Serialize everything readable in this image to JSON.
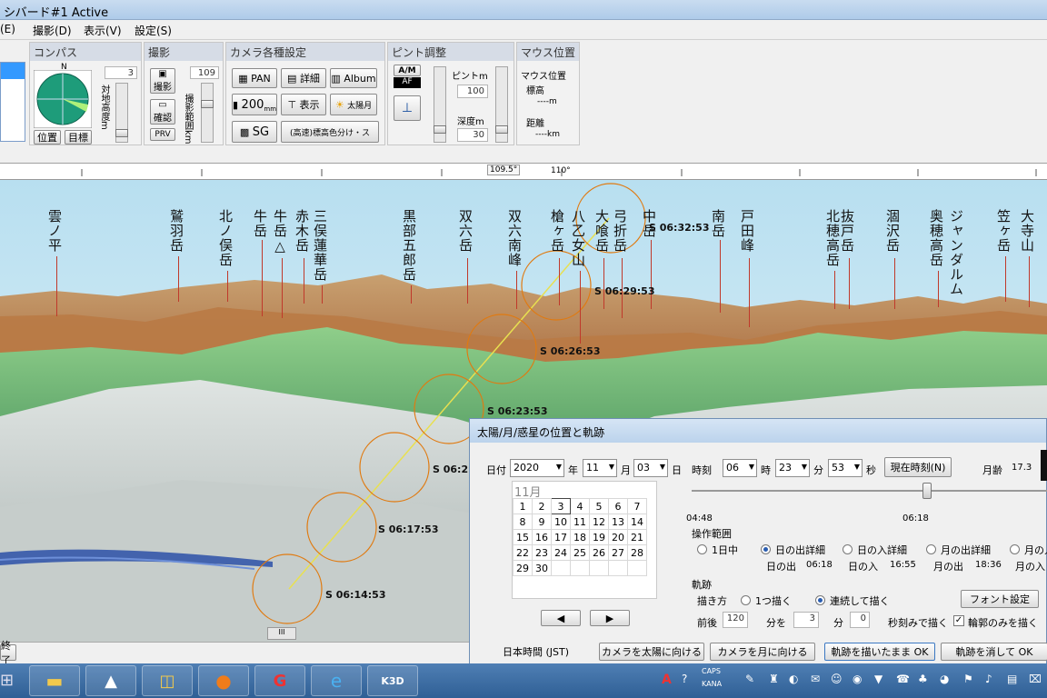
{
  "window": {
    "title": "シバード#1 Active"
  },
  "menu": [
    "(E)",
    "撮影(D)",
    "表示(V)",
    "設定(S)"
  ],
  "compass": {
    "title": "コンパス",
    "north": "N",
    "height_value": "3",
    "height_label": "対地高度m",
    "pos_button": "位置",
    "target_button": "目標"
  },
  "shoot": {
    "title": "撮影",
    "shoot_button": "撮影",
    "confirm_button": "確認",
    "prv_button": "PRV",
    "range_value": "109",
    "range_label": "撮影範囲km"
  },
  "camera": {
    "title": "カメラ各種設定",
    "pan": "PAN",
    "detail": "詳細",
    "album": "Album",
    "mm": "200",
    "mm_unit": "mm",
    "display": "表示",
    "sun_moon": "太陽月",
    "sg": "SG",
    "color_mode": "(高速)標高色分け・ス"
  },
  "focus": {
    "title": "ピント調整",
    "am": "A/M",
    "af": "AF",
    "focus_label": "ピントm",
    "focus_value": "100",
    "depth_label": "深度m",
    "depth_value": "30"
  },
  "mouse": {
    "title": "マウス位置",
    "pos_label": "マウス位置",
    "elev_label": "標高",
    "elev_value": "----m",
    "dist_label": "距離",
    "dist_value": "----km"
  },
  "ruler": {
    "marker": "109.5°",
    "label": "110°"
  },
  "peaks": [
    "雲ノ平",
    "鷲羽岳",
    "北ノ俣岳",
    "牛岳",
    "牛岳△",
    "赤木岳",
    "三俣蓮華岳",
    "黒部五郎岳",
    "双六岳",
    "双六南峰",
    "槍ヶ岳",
    "八乙女山",
    "大喰岳",
    "弓折岳",
    "中岳",
    "南岳",
    "戸田峰",
    "北穂高岳",
    "抜戸岳",
    "涸沢岳",
    "奥穂高岳",
    "ジャンダルム",
    "笠ヶ岳",
    "大寺山"
  ],
  "sun_labels": [
    "S 06:32:53",
    "S 06:29:53",
    "S 06:26:53",
    "S 06:23:53",
    "S 06:2",
    "S 06:17:53",
    "S 06:14:53"
  ],
  "status": {
    "left_button": "終了"
  },
  "dialog": {
    "title": "太陽/月/惑星の位置と軌跡",
    "date_label": "日付",
    "year": "2020",
    "year_unit": "年",
    "month": "11",
    "month_unit": "月",
    "day": "03",
    "day_unit": "日",
    "time_label": "時刻",
    "hour": "06",
    "hour_unit": "時",
    "minute": "23",
    "minute_unit": "分",
    "second": "53",
    "second_unit": "秒",
    "now_button": "現在時刻(N)",
    "moon_age_label": "月齢",
    "moon_age": "17.3",
    "cal_month": "11月",
    "cal_days": [
      [
        1,
        2,
        3,
        4,
        5,
        6,
        7
      ],
      [
        8,
        9,
        10,
        11,
        12,
        13,
        14
      ],
      [
        15,
        16,
        17,
        18,
        19,
        20,
        21
      ],
      [
        22,
        23,
        24,
        25,
        26,
        27,
        28
      ],
      [
        29,
        30
      ]
    ],
    "slider_start": "04:48",
    "slider_cur": "06:18",
    "op_range_title": "操作範囲",
    "op_options": [
      "1日中",
      "日の出詳細",
      "日の入詳細",
      "月の出詳細",
      "月の入"
    ],
    "sunrise_label": "日の出",
    "sunrise": "06:18",
    "sunset_label": "日の入",
    "sunset": "16:55",
    "moonrise_label": "月の出",
    "moonrise": "18:36",
    "moonset_label": "月の入",
    "track_title": "軌跡",
    "draw_label": "描き方",
    "draw_once": "1つ描く",
    "draw_cont": "連続して描く",
    "font_button": "フォント設定",
    "before_after_label": "前後",
    "ba_value": "120",
    "ba_unit": "分を",
    "step_value": "3",
    "step_unit": "分",
    "sec_value": "0",
    "sec_suffix": "秒刻みで描く",
    "outline_only": "輪郭のみを描く",
    "tz_label": "日本時間 (JST)",
    "btn_sun": "カメラを太陽に向ける",
    "btn_moon": "カメラを月に向ける",
    "btn_keep": "軌跡を描いたまま OK",
    "btn_clear": "軌跡を消して OK"
  },
  "tray": {
    "caps": "CAPS",
    "kana": "KANA"
  },
  "taskbar_apps": [
    "K3D"
  ]
}
